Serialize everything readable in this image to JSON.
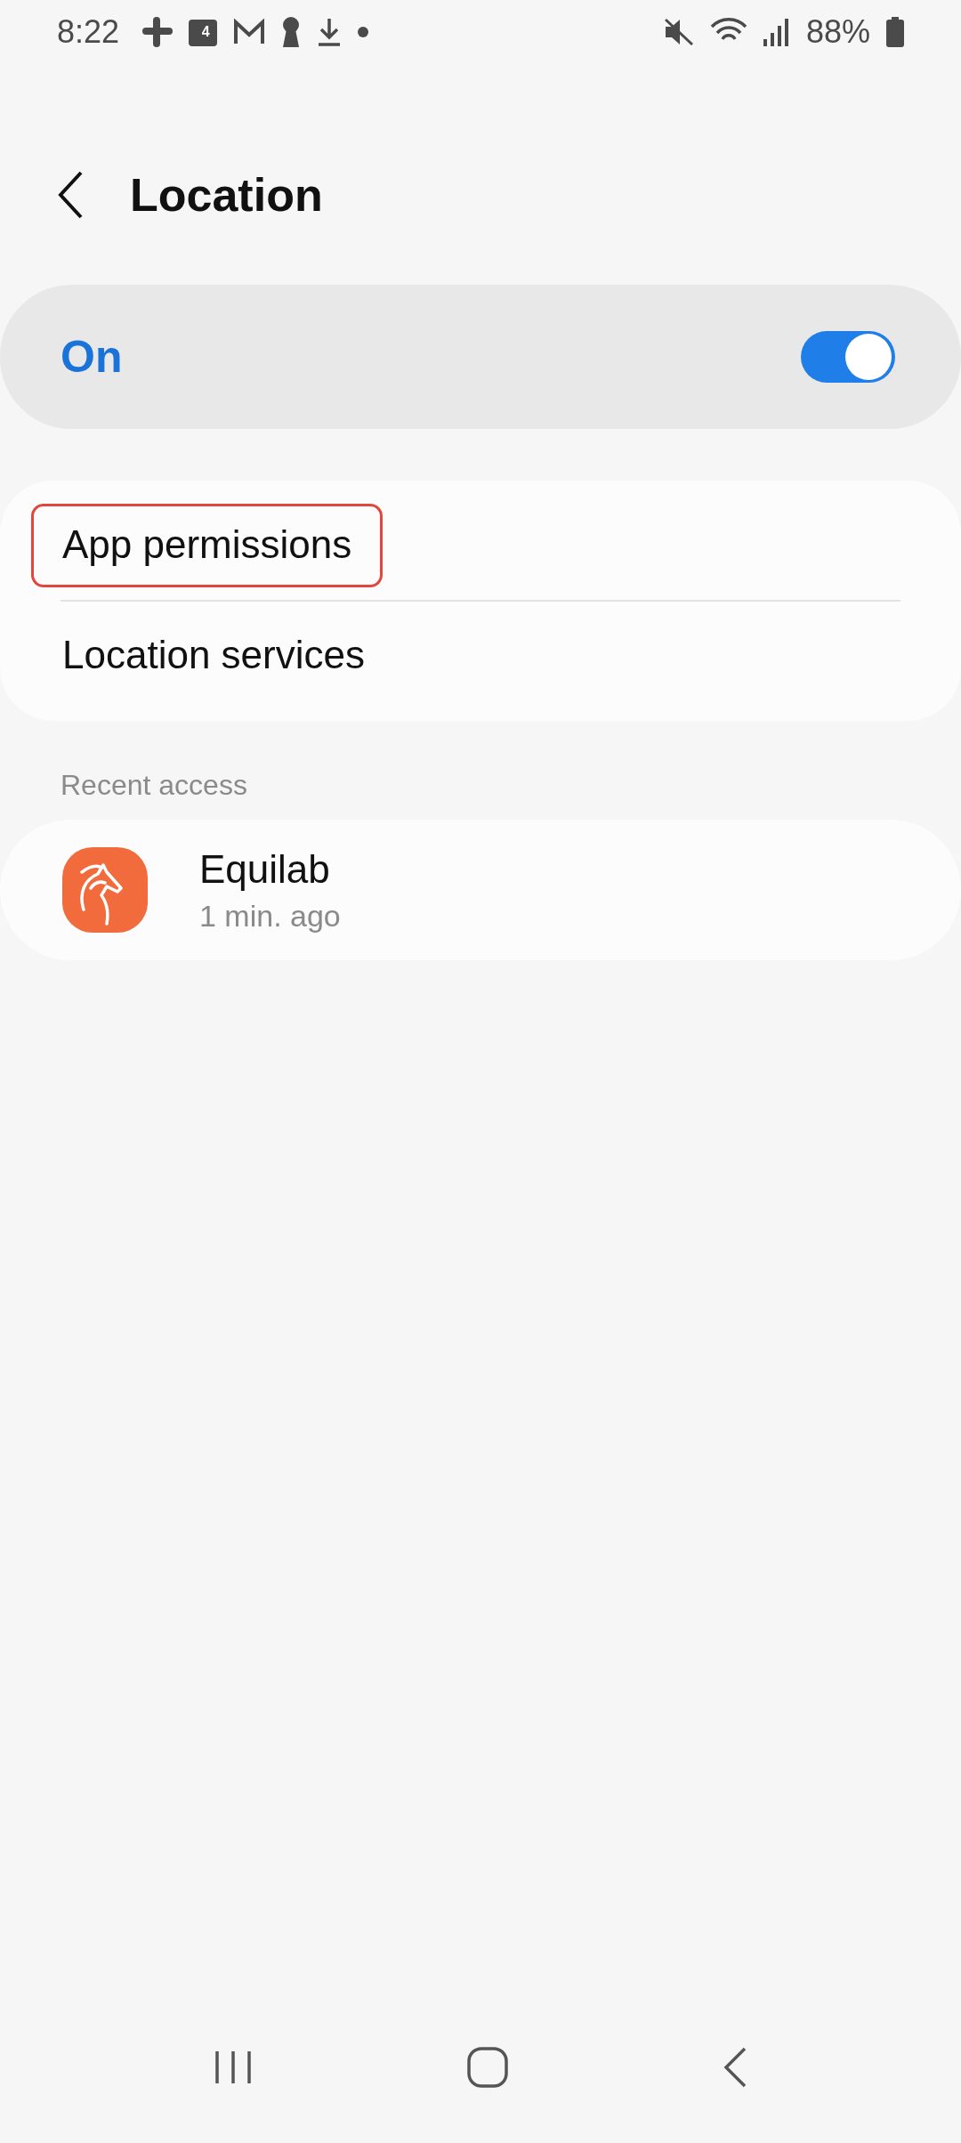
{
  "status_bar": {
    "time": "8:22",
    "calendar_day": "4",
    "battery": "88%"
  },
  "header": {
    "title": "Location"
  },
  "master_switch": {
    "label": "On",
    "on": true
  },
  "menu": [
    {
      "label": "App permissions",
      "highlighted": true
    },
    {
      "label": "Location services",
      "highlighted": false
    }
  ],
  "recent_access": {
    "heading": "Recent access",
    "apps": [
      {
        "name": "Equilab",
        "time": "1 min. ago"
      }
    ]
  }
}
